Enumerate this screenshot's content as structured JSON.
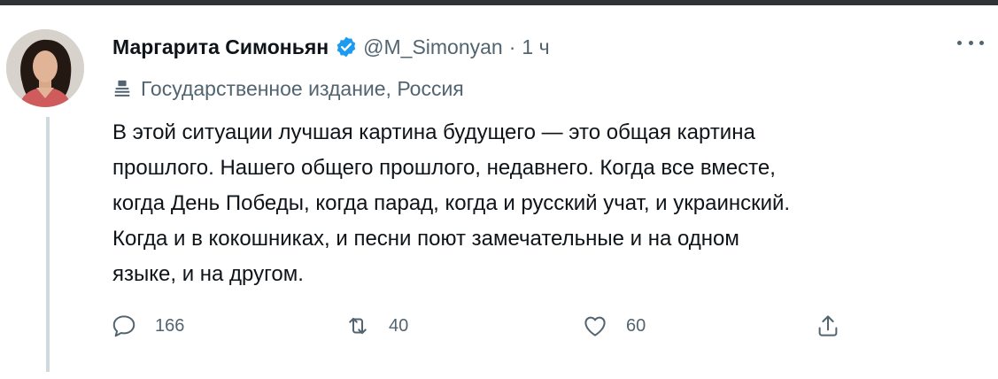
{
  "tweet": {
    "author_name": "Маргарита Симоньян",
    "handle": "@M_Simonyan",
    "separator": "·",
    "time": "1 ч",
    "label": "Государственное издание, Россия",
    "body_lines": [
      "В этой ситуации лучшая картина будущего — это общая картина",
      "прошлого. Нашего общего прошлого, недавнего. Когда все вместе,",
      "когда День Победы, когда парад, когда и русский учат, и украинский.",
      "Когда и в кокошниках, и песни поют замечательные и на одном",
      "языке, и на другом."
    ],
    "actions": {
      "reply_count": "166",
      "retweet_count": "40",
      "like_count": "60"
    }
  },
  "icons": {
    "verified": "verified-badge-icon",
    "label": "state-media-icon",
    "more": "more-icon",
    "reply": "reply-icon",
    "retweet": "retweet-icon",
    "like": "like-icon",
    "share": "share-icon"
  },
  "colors": {
    "verified_blue": "#1d9bf0",
    "text_primary": "#0f1419",
    "text_secondary": "#536471",
    "thread_line": "#cfd9de"
  }
}
